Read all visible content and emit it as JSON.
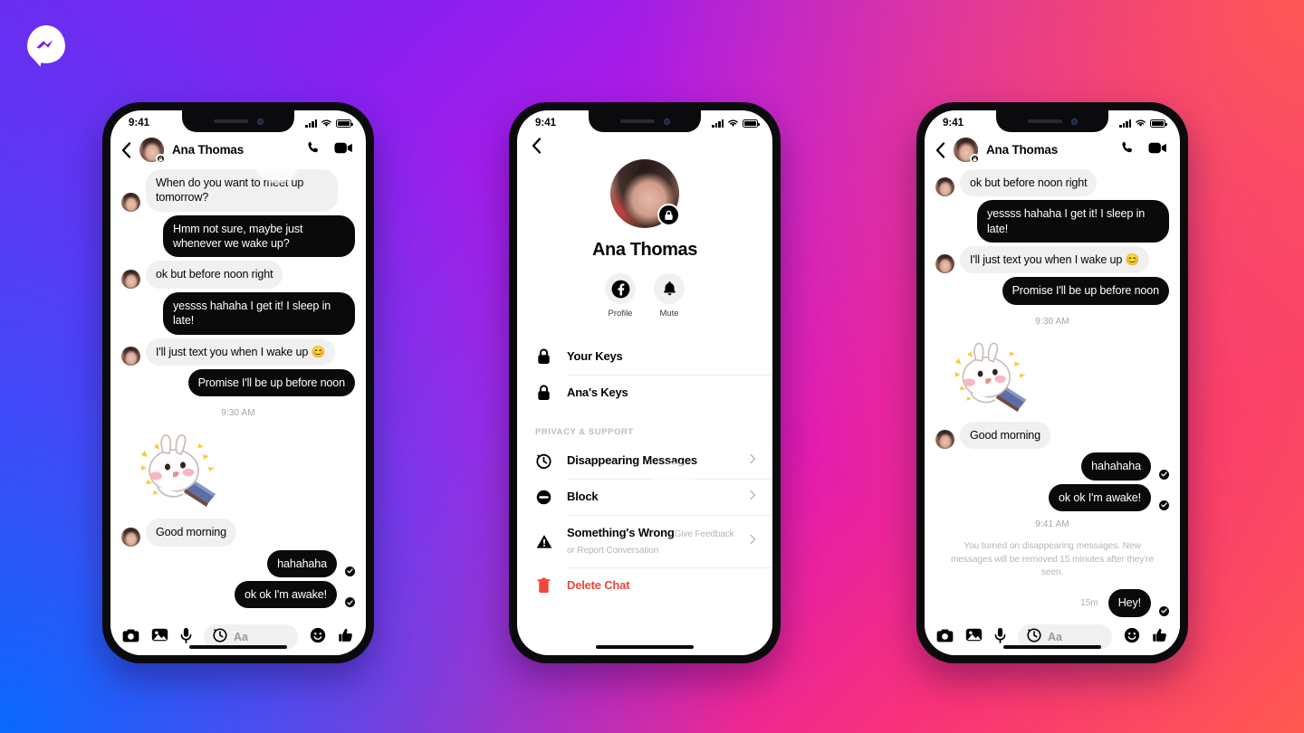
{
  "brand": {
    "logo_icon": "messenger-logo-icon",
    "accent_purple": "#7b1ff0",
    "accent_pink": "#f8317a",
    "accent_blue": "#0a7cff"
  },
  "status_bar": {
    "time": "9:41",
    "signal_icon": "signal-bars-icon",
    "wifi_icon": "wifi-icon",
    "battery_icon": "battery-icon"
  },
  "phone_1": {
    "header": {
      "back_icon": "back-chevron-icon",
      "avatar": "contact-avatar",
      "lock_badge_icon": "lock-badge-icon",
      "name": "Ana Thomas",
      "call_icon": "phone-call-icon",
      "video_icon": "video-call-icon"
    },
    "messages": [
      {
        "dir": "in",
        "text": "When do you want to meet up tomorrow?",
        "avatar": true
      },
      {
        "dir": "out",
        "text": "Hmm not sure, maybe just whenever we wake up?"
      },
      {
        "dir": "in",
        "text": "ok but before noon right",
        "avatar": true
      },
      {
        "dir": "out",
        "text": "yessss hahaha I get it! I sleep in late!"
      },
      {
        "dir": "in",
        "text": "I'll just text you when I wake up 😊",
        "avatar": true
      },
      {
        "dir": "out",
        "text": "Promise I'll be up before noon"
      }
    ],
    "daystamp": "9:30 AM",
    "sticker": "bunny-sticker",
    "messages_after": [
      {
        "dir": "in",
        "text": "Good morning",
        "avatar": true
      },
      {
        "dir": "out",
        "text": "hahahaha",
        "tick": true
      },
      {
        "dir": "out",
        "text": "ok ok I'm awake!",
        "tick": true
      }
    ],
    "composer": {
      "camera_icon": "camera-icon",
      "gallery_icon": "gallery-icon",
      "mic_icon": "microphone-icon",
      "timer_icon": "disappearing-timer-icon",
      "placeholder": "Aa",
      "emoji_icon": "emoji-smiley-icon",
      "like_icon": "thumbs-up-icon"
    }
  },
  "phone_2": {
    "back_icon": "back-chevron-icon",
    "avatar": "contact-avatar-large",
    "lock_badge_icon": "lock-badge-icon",
    "name": "Ana Thomas",
    "quick_actions": [
      {
        "icon": "facebook-icon",
        "label": "Profile"
      },
      {
        "icon": "bell-icon",
        "label": "Mute"
      }
    ],
    "keys_group": [
      {
        "icon": "lock-icon",
        "title": "Your Keys"
      },
      {
        "icon": "lock-icon",
        "title": "Ana's Keys"
      }
    ],
    "section_label": "PRIVACY & SUPPORT",
    "privacy_group": [
      {
        "icon": "history-clock-icon",
        "title": "Disappearing Messages",
        "sub": "",
        "chevron": true,
        "danger": false
      },
      {
        "icon": "block-icon",
        "title": "Block",
        "sub": "",
        "chevron": true,
        "danger": false
      },
      {
        "icon": "warning-icon",
        "title": "Something's Wrong",
        "sub": "Give Feedback or Report Conversation",
        "chevron": true,
        "danger": false
      },
      {
        "icon": "trash-icon",
        "title": "Delete Chat",
        "sub": "",
        "chevron": false,
        "danger": true
      }
    ]
  },
  "phone_3": {
    "header": {
      "back_icon": "back-chevron-icon",
      "avatar": "contact-avatar",
      "lock_badge_icon": "lock-badge-icon",
      "name": "Ana Thomas",
      "call_icon": "phone-call-icon",
      "video_icon": "video-call-icon"
    },
    "messages": [
      {
        "dir": "in",
        "text": "ok but before noon right",
        "avatar": true
      },
      {
        "dir": "out",
        "text": "yessss hahaha I get it! I sleep in late!"
      },
      {
        "dir": "in",
        "text": "I'll just text you when I wake up 😊",
        "avatar": true
      },
      {
        "dir": "out",
        "text": "Promise I'll be up before noon"
      }
    ],
    "daystamp": "9:30 AM",
    "sticker": "bunny-sticker",
    "messages_after": [
      {
        "dir": "in",
        "text": "Good morning",
        "avatar": true
      },
      {
        "dir": "out",
        "text": "hahahaha",
        "tick": true
      },
      {
        "dir": "out",
        "text": "ok ok I'm awake!",
        "tick": true
      }
    ],
    "daystamp_2": "9:41 AM",
    "system_note": "You turned on disappearing messages. New messages will be removed 15 minutes after they're seen.",
    "ephemeral": {
      "stamp": "15m",
      "text": "Hey!",
      "tick": true
    },
    "composer": {
      "camera_icon": "camera-icon",
      "gallery_icon": "gallery-icon",
      "mic_icon": "microphone-icon",
      "timer_icon": "disappearing-timer-icon",
      "placeholder": "Aa",
      "emoji_icon": "emoji-smiley-icon",
      "like_icon": "thumbs-up-icon"
    }
  }
}
